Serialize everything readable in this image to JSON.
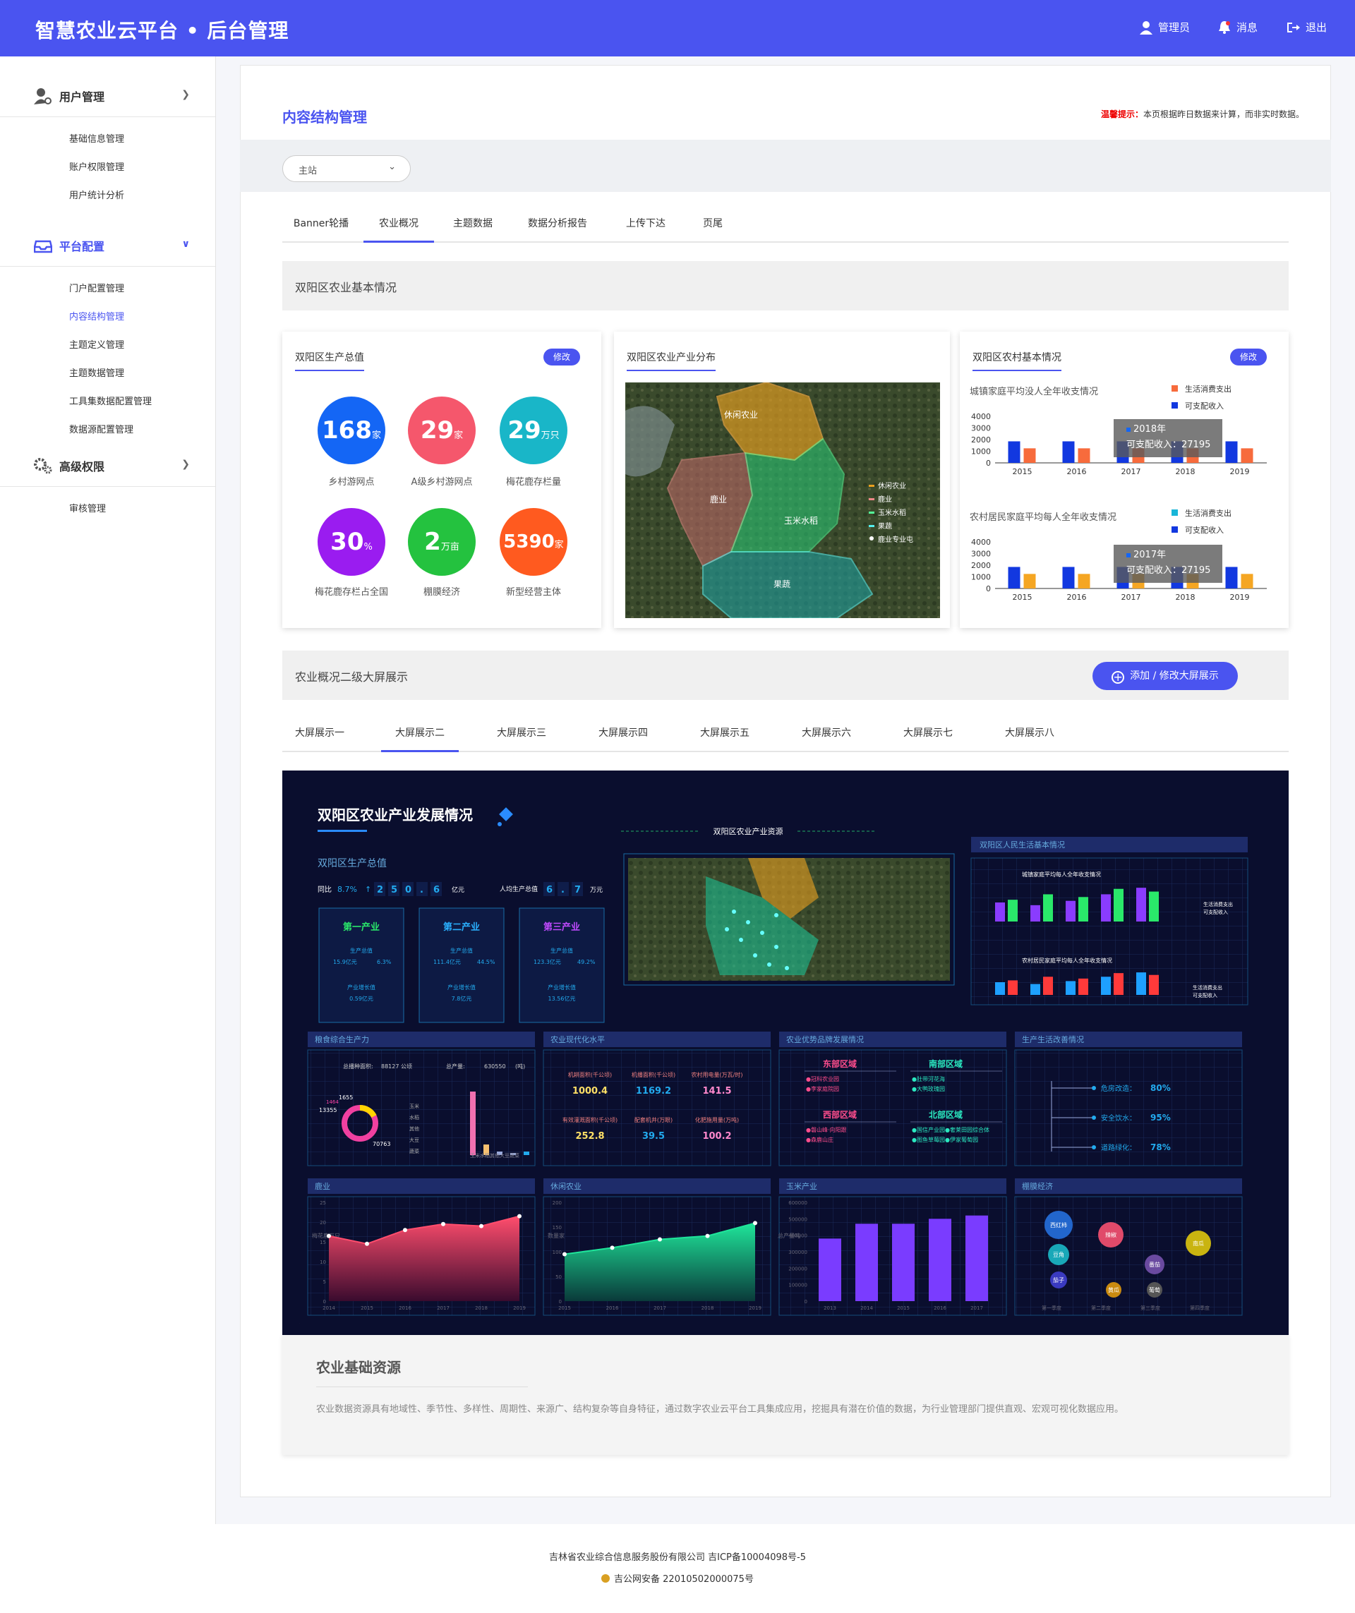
{
  "header": {
    "title": "智慧农业云平台 • 后台管理",
    "nav": [
      {
        "icon": "user-icon",
        "label": "管理员"
      },
      {
        "icon": "bell-icon",
        "label": "消息"
      },
      {
        "icon": "logout-icon",
        "label": "退出"
      }
    ]
  },
  "sidebar": {
    "groups": [
      {
        "label": "用户管理",
        "icon": "user-gear-icon",
        "items": [
          "基础信息管理",
          "账户权限管理",
          "用户统计分析"
        ]
      },
      {
        "label": "平台配置",
        "icon": "inbox-icon",
        "items": [
          "门户配置管理",
          "内容结构管理",
          "主题定义管理",
          "主题数据管理",
          "工具集数据配置管理",
          "数据源配置管理"
        ],
        "active_item": "内容结构管理"
      },
      {
        "label": "高级权限",
        "icon": "gears-icon",
        "items": [
          "审核管理"
        ]
      }
    ]
  },
  "page": {
    "title": "内容结构管理",
    "tip_label": "温馨提示：",
    "tip_text": "本页根据昨日数据来计算，而非实时数据。",
    "select_value": "主站"
  },
  "tabs": [
    "Banner轮播",
    "农业概况",
    "主题数据",
    "数据分析报告",
    "上传下达",
    "页尾"
  ],
  "section1": {
    "title": "双阳区农业基本情况"
  },
  "card_gdp": {
    "title": "双阳区生产总值",
    "edit": "修改",
    "items": [
      {
        "value": "168",
        "unit": "家",
        "label": "乡村游网点",
        "color": "#1466f5"
      },
      {
        "value": "29",
        "unit": "家",
        "label": "A级乡村游网点",
        "color": "#f5576c"
      },
      {
        "value": "29",
        "unit": "万只",
        "label": "梅花鹿存栏量",
        "color": "#19b6c8"
      },
      {
        "value": "30",
        "unit": "%",
        "label": "梅花鹿存栏占全国",
        "color": "#9a1cf0"
      },
      {
        "value": "2",
        "unit": "万亩",
        "label": "棚膜经济",
        "color": "#24c23f"
      },
      {
        "value": "5390",
        "unit": "家",
        "label": "新型经营主体",
        "color": "#ff5a1f"
      }
    ]
  },
  "card_map": {
    "title": "双阳区农业产业分布",
    "regions": [
      "休闲农业",
      "鹿业",
      "玉米水稻",
      "果蔬"
    ],
    "legend": [
      "休闲农业",
      "鹿业",
      "玉米水稻",
      "果蔬",
      "鹿业专业屯"
    ]
  },
  "card_rural": {
    "title": "双阳区农村基本情况",
    "edit": "修改",
    "chart1": {
      "title": "城镇家庭平均没人全年收支情况",
      "legend": [
        "生活消费支出",
        "可支配收入"
      ],
      "tooltip_year": "2018年",
      "tooltip_text": "可支配收入：27195"
    },
    "chart2": {
      "title": "农村居民家庭平均每人全年收支情况",
      "legend": [
        "生活消费支出",
        "可支配收入"
      ],
      "tooltip_year": "2017年",
      "tooltip_text": "可支配收入：27195"
    }
  },
  "chart_data": [
    {
      "type": "bar",
      "title": "城镇家庭平均没人全年收支情况",
      "categories": [
        "2015",
        "2016",
        "2017",
        "2018",
        "2019"
      ],
      "ylim": [
        0,
        4000
      ],
      "yticks": [
        "4000",
        "3000",
        "2000",
        "1000",
        "0"
      ],
      "series": [
        {
          "name": "可支配收入",
          "values": [
            1850,
            1850,
            1850,
            1850,
            1850
          ],
          "color": "#1238e0"
        },
        {
          "name": "生活消费支出",
          "values": [
            1250,
            1250,
            1250,
            1250,
            1250
          ],
          "color": "#f76b3c"
        }
      ]
    },
    {
      "type": "bar",
      "title": "农村居民家庭平均每人全年收支情况",
      "categories": [
        "2015",
        "2016",
        "2017",
        "2018",
        "2019"
      ],
      "ylim": [
        0,
        4000
      ],
      "yticks": [
        "4000",
        "3000",
        "2000",
        "1000",
        "0"
      ],
      "series": [
        {
          "name": "可支配收入",
          "values": [
            1850,
            1850,
            1850,
            1850,
            1850
          ],
          "color": "#1238e0"
        },
        {
          "name": "生活消费支出",
          "values": [
            1250,
            1250,
            1250,
            1250,
            1250
          ],
          "color": "#f5a623"
        }
      ]
    }
  ],
  "section2": {
    "title": "农业概况二级大屏展示",
    "add_button": "添加 / 修改大屏展示"
  },
  "screen_tabs": [
    "大屏展示一",
    "大屏展示二",
    "大屏展示三",
    "大屏展示四",
    "大屏展示五",
    "大屏展示六",
    "大屏展示七",
    "大屏展示八"
  ],
  "dash": {
    "title": "双阳区农业产业发展情况",
    "gdp_title": "双阳区生产总值",
    "yoy": "同比",
    "yoy_val": "8.7%",
    "gdp_digits": [
      "2",
      "5",
      "0",
      ".",
      "6"
    ],
    "gdp_unit": "亿元",
    "per_label": "人均生产总值",
    "per_digits": [
      "6",
      ".",
      "7"
    ],
    "per_unit": "万元",
    "industries": [
      {
        "name": "第一产业",
        "l1": "生产总值",
        "v1": "15.9亿元",
        "v2": "6.3%",
        "l2": "产业增长值",
        "v3": "0.59亿元"
      },
      {
        "name": "第二产业",
        "l1": "生产总值",
        "v1": "111.4亿元",
        "v2": "44.5%",
        "l2": "产业增长值",
        "v3": "7.8亿元"
      },
      {
        "name": "第三产业",
        "l1": "生产总值",
        "v1": "123.3亿元",
        "v2": "49.2%",
        "l2": "产业增长值",
        "v3": "13.56亿元"
      }
    ],
    "resource_title": "双阳区农业产业资源",
    "life_title": "双阳区人民生活基本情况",
    "life1": "城镇家庭平均每人全年收支情况",
    "life2": "农村居民家庭平均每人全年收支情况",
    "life_legend": [
      "生活消费支出",
      "可支配收入"
    ],
    "grain": {
      "title": "粮食综合生产力",
      "area_label": "总播种面积:",
      "area": "88127",
      "area_unit": "公顷",
      "prod_label": "总产量:",
      "prod": "630550",
      "prod_unit": "(吨)",
      "n1": "1655",
      "n2": "1464",
      "n3": "13355",
      "n4": "70763",
      "legend": [
        "玉米",
        "水稻",
        "其他",
        "大豆",
        "蔬菜"
      ],
      "bars": "玉米水稻其他大豆蔬菜"
    },
    "modern": {
      "title": "农业现代化水平",
      "items": [
        {
          "label": "机耕面积(千公顷)",
          "value": "1000.4"
        },
        {
          "label": "机播面积(千公顷)",
          "value": "1169.2"
        },
        {
          "label": "农村用电量(万瓦/时)",
          "value": "141.5"
        },
        {
          "label": "有效灌溉面积(千公顷)",
          "value": "252.8"
        },
        {
          "label": "配套机井(万眼)",
          "value": "39.5"
        },
        {
          "label": "化肥施用量(万吨)",
          "value": "100.2"
        }
      ]
    },
    "brand": {
      "title": "农业优势品牌发展情况",
      "regions": [
        {
          "name": "东部区域",
          "items": [
            "●冠科农业园",
            "●李家庭院园"
          ]
        },
        {
          "name": "南部区域",
          "items": [
            "●肚带河花海",
            "●大鸭玫瑰园"
          ]
        },
        {
          "name": "西部区域",
          "items": [
            "●磐山峰·向阳跟",
            "●森鹿山庄"
          ]
        },
        {
          "name": "北部区域",
          "items": [
            "●国信产业园●奢莱田园综合体",
            "●图鱼草莓园●伊家葡萄园"
          ]
        }
      ]
    },
    "improve": {
      "title": "生产生活改善情况",
      "items": [
        {
          "label": "危房改造：",
          "value": "80%"
        },
        {
          "label": "安全饮水：",
          "value": "95%"
        },
        {
          "label": "道路绿化：",
          "value": "78%"
        }
      ]
    },
    "deer": {
      "title": "鹿业",
      "ylabel": "梅花鹿万只",
      "years": [
        "2014",
        "2015",
        "2016",
        "2017",
        "2018",
        "2019"
      ],
      "values": [
        16.5,
        14.5,
        18,
        19.5,
        19,
        21.5
      ],
      "yticks": [
        "25",
        "20",
        "15",
        "10",
        "5",
        "0"
      ]
    },
    "leisure": {
      "title": "休闲农业",
      "ylabel": "数量家",
      "years": [
        "2015",
        "2016",
        "2017",
        "2018",
        "2019"
      ],
      "values": [
        95,
        108,
        125,
        132,
        158
      ],
      "yticks": [
        "200",
        "150",
        "100",
        "50",
        "0"
      ]
    },
    "corn": {
      "title": "玉米产业",
      "ylabel": "总产量吨",
      "years": [
        "2013",
        "2014",
        "2015",
        "2016",
        "2017"
      ],
      "values": [
        380000,
        470000,
        470000,
        500000,
        520000
      ],
      "yticks": [
        "600000",
        "500000",
        "400000",
        "300000",
        "200000",
        "100000",
        "0"
      ]
    },
    "shed": {
      "title": "棚膜经济",
      "bubbles": [
        "西红柿",
        "辣椒",
        "豆角",
        "南瓜",
        "番茄",
        "茄子",
        "黄瓜",
        "葡萄"
      ],
      "quarters": [
        "第一季度",
        "第二季度",
        "第三季度",
        "第四季度"
      ]
    }
  },
  "base": {
    "title": "农业基础资源",
    "text": "农业数据资源具有地域性、季节性、多样性、周期性、来源广、结构复杂等自身特征，通过数字农业云平台工具集成应用，挖掘具有潜在价值的数据，为行业管理部门提供直观、宏观可视化数据应用。"
  },
  "footer": {
    "line1": "吉林省农业综合信息服务股份有限公司 吉ICP备10004098号-5",
    "line2": "吉公网安备 22010502000075号"
  }
}
